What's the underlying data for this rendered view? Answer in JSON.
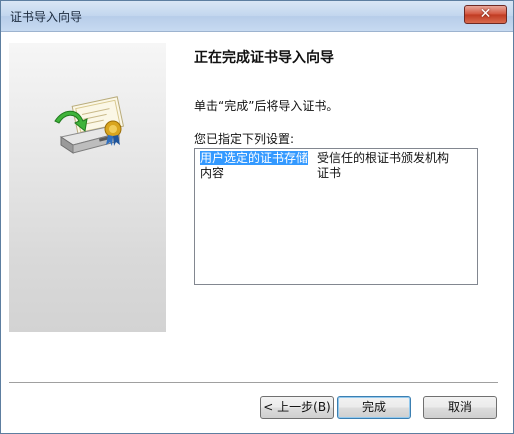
{
  "window": {
    "title": "证书导入向导",
    "close_symbol": "✕"
  },
  "page": {
    "heading": "正在完成证书导入向导",
    "description": "单击“完成”后将导入证书。",
    "list_label": "您已指定下列设置:"
  },
  "settings": [
    {
      "key": "用户选定的证书存储",
      "value": "受信任的根证书颁发机构",
      "selected": true
    },
    {
      "key": "内容",
      "value": "证书",
      "selected": false
    }
  ],
  "buttons": {
    "back": "< 上一步(B)",
    "finish": "完成",
    "cancel": "取消"
  },
  "icons": {
    "wizard": "certificate-import-icon",
    "close": "close-icon"
  },
  "colors": {
    "selection": "#3399ff",
    "close_button": "#c8432a",
    "titlebar": "#c2d6ee"
  }
}
